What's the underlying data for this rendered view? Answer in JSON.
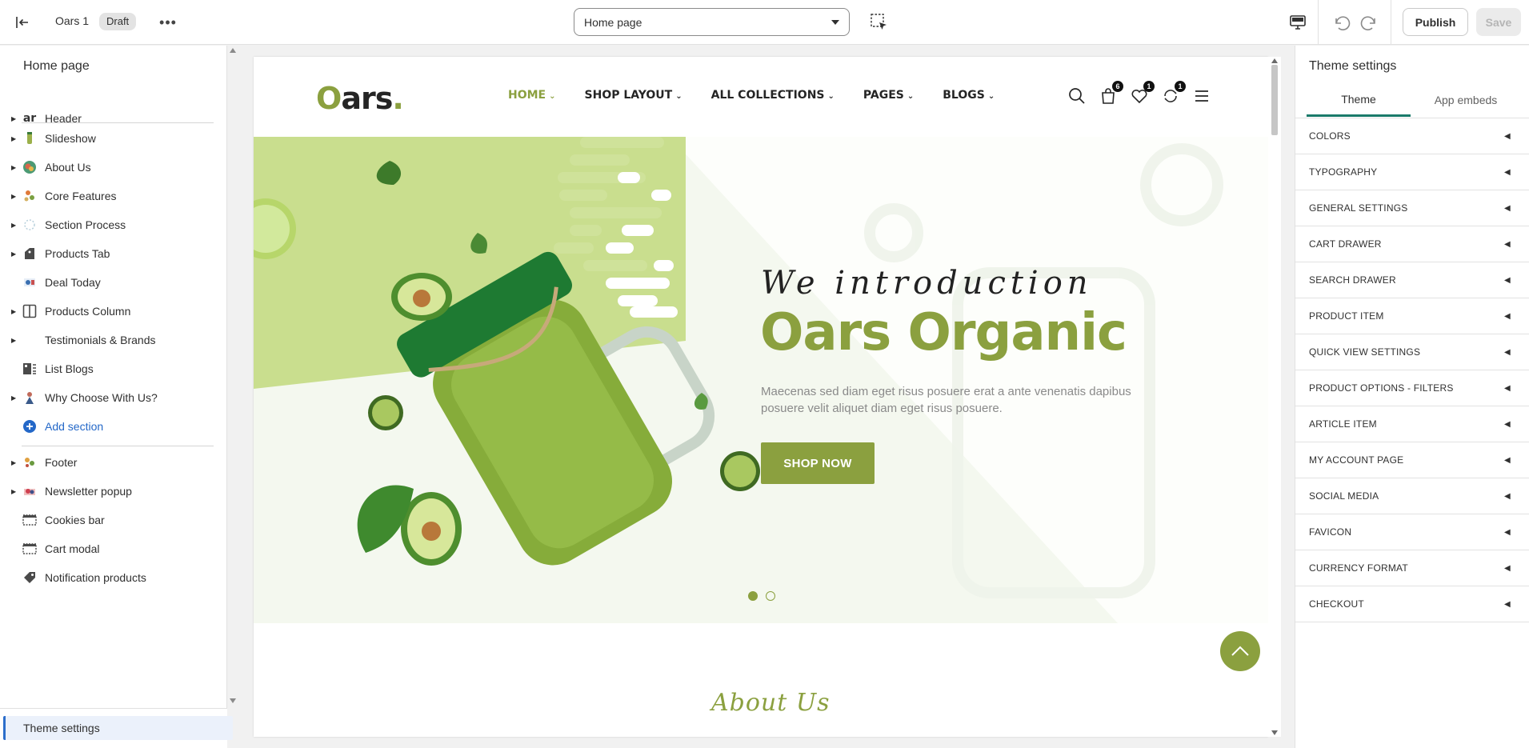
{
  "topbar": {
    "theme_name": "Oars 1",
    "status_badge": "Draft",
    "more_label": "•••",
    "page_select": "Home page",
    "publish_label": "Publish",
    "save_label": "Save"
  },
  "sidebar": {
    "title": "Home page",
    "items": [
      {
        "label": "Header",
        "icon": "header-thumb-icon",
        "caret": true
      },
      {
        "label": "Slideshow",
        "icon": "slideshow-thumb-icon",
        "caret": true
      },
      {
        "label": "About Us",
        "icon": "about-thumb-icon",
        "caret": true
      },
      {
        "label": "Core Features",
        "icon": "features-thumb-icon",
        "caret": true
      },
      {
        "label": "Section Process",
        "icon": "process-thumb-icon",
        "caret": true
      },
      {
        "label": "Products Tab",
        "icon": "tag-icon",
        "caret": true
      },
      {
        "label": "Deal Today",
        "icon": "deal-thumb-icon",
        "caret": false
      },
      {
        "label": "Products Column",
        "icon": "columns-icon",
        "caret": true
      },
      {
        "label": "Testimonials & Brands",
        "icon": "",
        "caret": true
      },
      {
        "label": "List Blogs",
        "icon": "blog-icon",
        "caret": false
      },
      {
        "label": "Why Choose With Us?",
        "icon": "why-thumb-icon",
        "caret": true
      }
    ],
    "add_section": "Add section",
    "footer_items": [
      {
        "label": "Footer",
        "icon": "footer-thumb-icon",
        "caret": true
      },
      {
        "label": "Newsletter popup",
        "icon": "newsletter-thumb-icon",
        "caret": true
      },
      {
        "label": "Cookies bar",
        "icon": "bar-layout-icon",
        "caret": false
      },
      {
        "label": "Cart modal",
        "icon": "bar-layout-icon",
        "caret": false
      },
      {
        "label": "Notification products",
        "icon": "tag-icon",
        "caret": false
      }
    ],
    "theme_settings": "Theme settings"
  },
  "store": {
    "logo_o": "O",
    "logo_rest": "ars",
    "logo_dot": ".",
    "nav": [
      "HOME",
      "SHOP LAYOUT",
      "ALL COLLECTIONS",
      "PAGES",
      "BLOGS"
    ],
    "cart_count": "6",
    "wishlist_count": "1",
    "compare_count": "1",
    "hero_intro": "We introduction",
    "hero_title": "Oars Organic",
    "hero_desc": "Maecenas sed diam eget risus posuere erat a ante venenatis dapibus posuere velit aliquet diam eget risus posuere.",
    "hero_button": "SHOP NOW",
    "about_script": "About Us",
    "accent": "#8ba03f"
  },
  "theme_panel": {
    "title": "Theme settings",
    "tabs": [
      "Theme",
      "App embeds"
    ],
    "rows": [
      "COLORS",
      "TYPOGRAPHY",
      "GENERAL SETTINGS",
      "CART DRAWER",
      "SEARCH DRAWER",
      "PRODUCT ITEM",
      "QUICK VIEW SETTINGS",
      "PRODUCT OPTIONS - FILTERS",
      "ARTICLE ITEM",
      "MY ACCOUNT PAGE",
      "SOCIAL MEDIA",
      "FAVICON",
      "CURRENCY FORMAT",
      "CHECKOUT"
    ]
  }
}
